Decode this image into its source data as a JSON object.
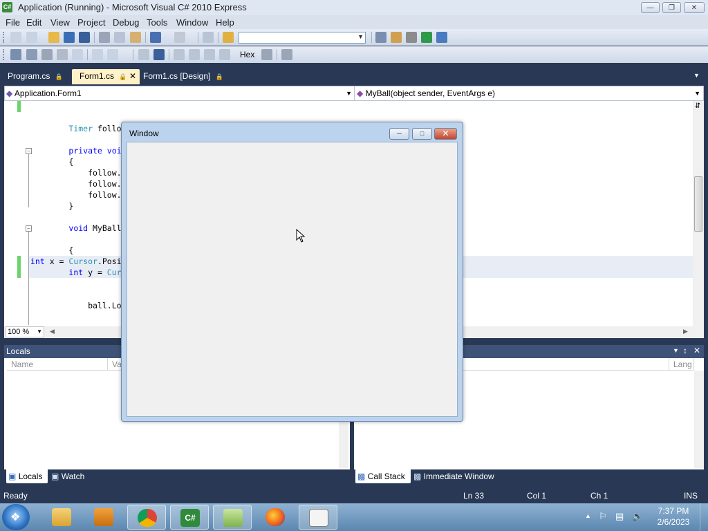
{
  "window": {
    "title": "Application (Running) - Microsoft Visual C# 2010 Express",
    "app_icon_text": "C#"
  },
  "menu": [
    "File",
    "Edit",
    "View",
    "Project",
    "Debug",
    "Tools",
    "Window",
    "Help"
  ],
  "toolbar": {
    "hex_label": "Hex",
    "config_combo_value": ""
  },
  "doc_tabs": [
    {
      "label": "Program.cs",
      "active": false
    },
    {
      "label": "Form1.cs",
      "active": true
    },
    {
      "label": "Form1.cs [Design]",
      "active": false
    }
  ],
  "navbar": {
    "type_combo": "Application.Form1",
    "member_combo": "MyBall(object sender, EventArgs e)"
  },
  "code_lines": [
    {
      "indent": "        ",
      "parts": [
        {
          "t": "ty",
          "v": "Timer"
        },
        {
          "t": "",
          "v": " follo"
        }
      ]
    },
    {
      "indent": "        ",
      "parts": [
        {
          "t": "kw",
          "v": "private"
        },
        {
          "t": "",
          "v": " "
        },
        {
          "t": "kw",
          "v": "voi"
        }
      ]
    },
    {
      "indent": "        ",
      "parts": [
        {
          "t": "",
          "v": "{"
        }
      ]
    },
    {
      "indent": "            ",
      "parts": [
        {
          "t": "",
          "v": "follow."
        }
      ]
    },
    {
      "indent": "            ",
      "parts": [
        {
          "t": "",
          "v": "follow."
        }
      ]
    },
    {
      "indent": "            ",
      "parts": [
        {
          "t": "",
          "v": "follow."
        }
      ]
    },
    {
      "indent": "        ",
      "parts": [
        {
          "t": "",
          "v": "}"
        }
      ]
    },
    {
      "indent": "        ",
      "parts": [
        {
          "t": "kw",
          "v": "void"
        },
        {
          "t": "",
          "v": " MyBall"
        }
      ]
    },
    {
      "indent": "        ",
      "parts": [
        {
          "t": "",
          "v": "{"
        }
      ]
    },
    {
      "indent": "",
      "parts": [
        {
          "t": "kw",
          "v": "int"
        },
        {
          "t": "",
          "v": " x = "
        },
        {
          "t": "ty",
          "v": "Cursor"
        },
        {
          "t": "",
          "v": ".Posi"
        }
      ]
    },
    {
      "indent": "        ",
      "parts": [
        {
          "t": "kw",
          "v": "int"
        },
        {
          "t": "",
          "v": " y = "
        },
        {
          "t": "ty",
          "v": "Cur"
        }
      ]
    },
    {
      "indent": "            ",
      "parts": [
        {
          "t": "",
          "v": "ball.Lo"
        }
      ]
    }
  ],
  "editor": {
    "zoom": "100 %"
  },
  "locals_pane": {
    "title": "Locals",
    "columns": [
      "Name",
      "Va"
    ],
    "tabs": [
      {
        "label": "Locals",
        "active": true
      },
      {
        "label": "Watch",
        "active": false
      }
    ]
  },
  "callstack_pane": {
    "columns": [
      "Lang"
    ],
    "tabs": [
      {
        "label": "Call Stack",
        "active": true
      },
      {
        "label": "Immediate Window",
        "active": false
      }
    ]
  },
  "status": {
    "text": "Ready",
    "ln": "Ln 33",
    "col": "Col 1",
    "ch": "Ch 1",
    "mode": "INS"
  },
  "form_window": {
    "title": "Window"
  },
  "taskbar": {
    "apps": [
      "explorer-icon",
      "media-player-icon",
      "chrome-icon",
      "visual-csharp-icon",
      "notepad-plus-plus-icon",
      "firefox-icon",
      "application-window-icon"
    ],
    "time": "7:37 PM",
    "date": "2/6/2023"
  },
  "colors": {
    "accent": "#293955",
    "active_tab": "#fff1c8",
    "keyword": "#0000ff",
    "type": "#2b91af"
  }
}
